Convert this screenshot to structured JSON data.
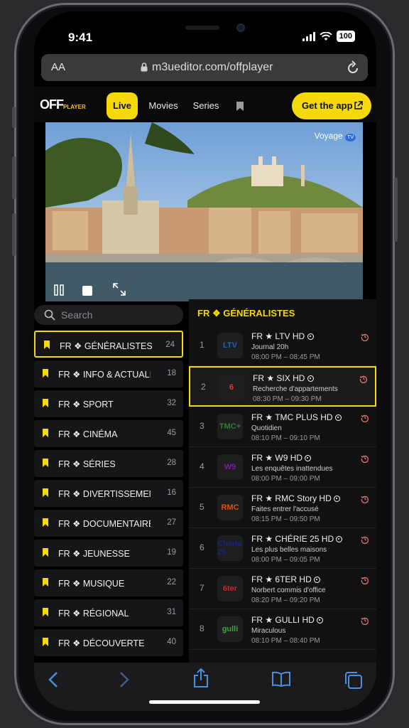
{
  "status_bar": {
    "time": "9:41",
    "battery": "100"
  },
  "browser": {
    "text_size_label": "AA",
    "url": "m3ueditor.com/offplayer"
  },
  "app": {
    "logo_text": "OFF",
    "logo_sub": "PLAYER",
    "nav": [
      {
        "label": "Live",
        "active": true
      },
      {
        "label": "Movies",
        "active": false
      },
      {
        "label": "Series",
        "active": false
      }
    ],
    "get_app_label": "Get the app"
  },
  "player": {
    "channel_badge": "Voyage",
    "badge_tv": "TV"
  },
  "search": {
    "placeholder": "Search"
  },
  "categories": [
    {
      "label": "FR ❖ GÉNÉRALISTES",
      "count": "24",
      "active": true
    },
    {
      "label": "FR ❖ INFO & ACTUALITÉS",
      "count": "18",
      "active": false
    },
    {
      "label": "FR ❖ SPORT",
      "count": "32",
      "active": false
    },
    {
      "label": "FR ❖ CINÉMA",
      "count": "45",
      "active": false
    },
    {
      "label": "FR ❖ SÉRIES",
      "count": "28",
      "active": false
    },
    {
      "label": "FR ❖ DIVERTISSEMENT",
      "count": "16",
      "active": false
    },
    {
      "label": "FR ❖ DOCUMENTAIRES",
      "count": "27",
      "active": false
    },
    {
      "label": "FR ❖ JEUNESSE",
      "count": "19",
      "active": false
    },
    {
      "label": "FR ❖ MUSIQUE",
      "count": "22",
      "active": false
    },
    {
      "label": "FR ❖ RÉGIONAL",
      "count": "31",
      "active": false
    },
    {
      "label": "FR ❖ DÉCOUVERTE",
      "count": "40",
      "active": false
    }
  ],
  "channels_heading": "FR ❖ GÉNÉRALISTES",
  "channels": [
    {
      "num": "1",
      "logo": "LTV",
      "logo_color": "#1565c0",
      "name": "FR ★ LTV HD",
      "show": "Journal 20h",
      "time": "08:00 PM – 08:45 PM",
      "active": false
    },
    {
      "num": "2",
      "logo": "6",
      "logo_color": "#e53935",
      "name": "FR ★ SIX HD",
      "show": "Recherche d'appartements",
      "time": "08:30 PM – 09:30 PM",
      "active": true
    },
    {
      "num": "3",
      "logo": "TMC+",
      "logo_color": "#2e7d32",
      "name": "FR ★ TMC PLUS HD",
      "show": "Quotidien",
      "time": "08:10 PM – 09:10 PM",
      "active": false
    },
    {
      "num": "4",
      "logo": "W9",
      "logo_color": "#7b1fa2",
      "name": "FR ★ W9 HD",
      "show": "Les enquêtes inattendues",
      "time": "08:00 PM – 09:00 PM",
      "active": false
    },
    {
      "num": "5",
      "logo": "RMC",
      "logo_color": "#e65100",
      "name": "FR ★ RMC Story HD",
      "show": "Faites entrer l'accusé",
      "time": "08:15 PM – 09:50 PM",
      "active": false
    },
    {
      "num": "6",
      "logo": "Chérie 25",
      "logo_color": "#1a237e",
      "name": "FR ★ CHÉRIE 25 HD",
      "show": "Les plus belles maisons",
      "time": "08:00 PM – 09:05 PM",
      "active": false
    },
    {
      "num": "7",
      "logo": "6ter",
      "logo_color": "#c62828",
      "name": "FR ★ 6TER HD",
      "show": "Norbert commis d'office",
      "time": "08:20 PM – 09:20 PM",
      "active": false
    },
    {
      "num": "8",
      "logo": "gulli",
      "logo_color": "#43a047",
      "name": "FR ★ GULLI HD",
      "show": "Miraculous",
      "time": "08:10 PM – 08:40 PM",
      "active": false
    }
  ],
  "colors": {
    "accent": "#f5d90a",
    "background": "#000000"
  }
}
